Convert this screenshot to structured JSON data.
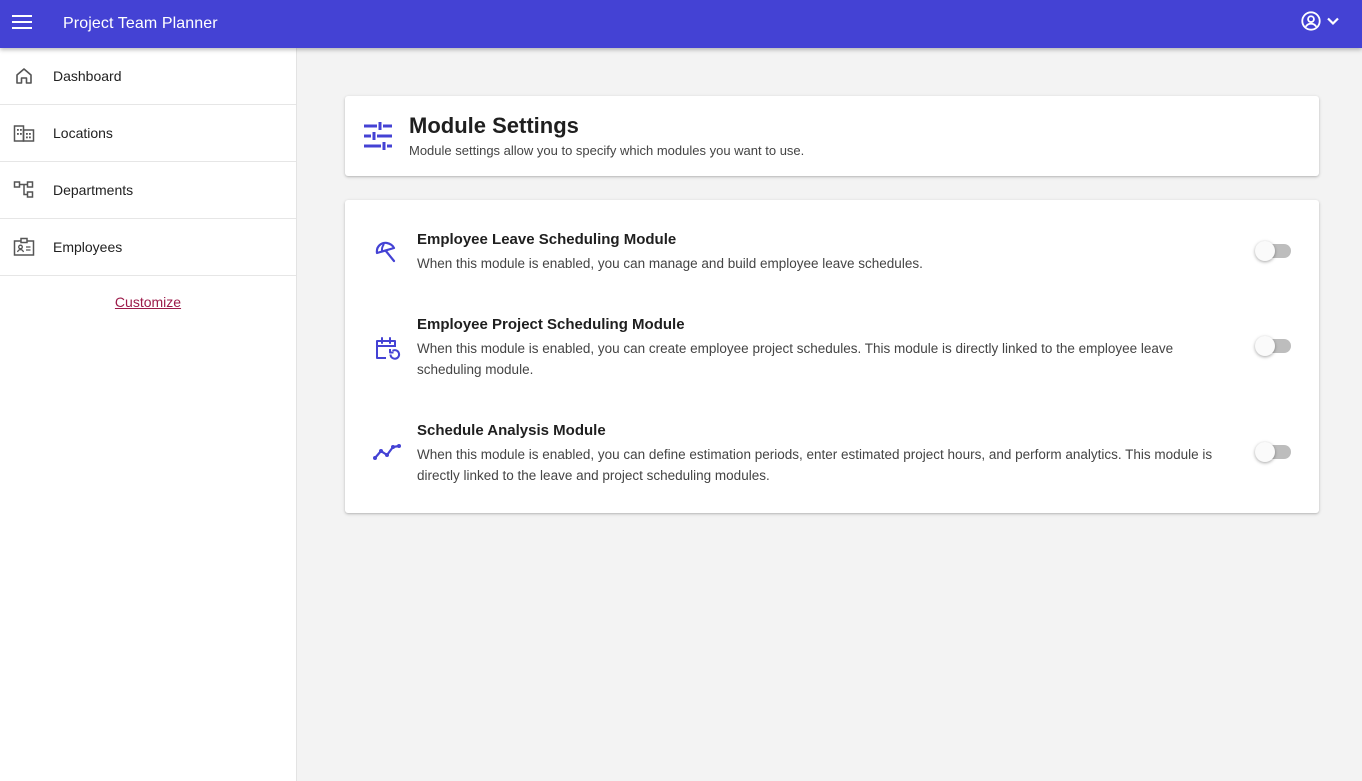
{
  "app": {
    "title": "Project Team Planner"
  },
  "icons": {
    "menu": "menu-icon",
    "account": "account-circle-icon",
    "account_dropdown": "chevron-down-icon",
    "settings": "tune-icon"
  },
  "colors": {
    "primary": "#4442d4",
    "link": "#9c1b4a",
    "background": "#f3f3f3"
  },
  "sidebar": {
    "items": [
      {
        "label": "Dashboard",
        "icon": "home-icon"
      },
      {
        "label": "Locations",
        "icon": "building-icon"
      },
      {
        "label": "Departments",
        "icon": "hierarchy-icon"
      },
      {
        "label": "Employees",
        "icon": "id-badge-icon"
      }
    ],
    "customize_label": "Customize"
  },
  "header": {
    "title": "Module Settings",
    "subtitle": "Module settings allow you to specify which modules you want to use."
  },
  "modules": [
    {
      "title": "Employee Leave Scheduling Module",
      "description": "When this module is enabled, you can manage and build employee leave schedules.",
      "icon": "beach-umbrella-icon",
      "enabled": false
    },
    {
      "title": "Employee Project Scheduling Module",
      "description": "When this module is enabled, you can create employee project schedules. This module is directly linked to the employee leave scheduling module.",
      "icon": "calendar-refresh-icon",
      "enabled": false
    },
    {
      "title": "Schedule Analysis Module",
      "description": "When this module is enabled, you can define estimation periods, enter estimated project hours, and perform analytics. This module is directly linked to the leave and project scheduling modules.",
      "icon": "trend-line-icon",
      "enabled": false
    }
  ]
}
